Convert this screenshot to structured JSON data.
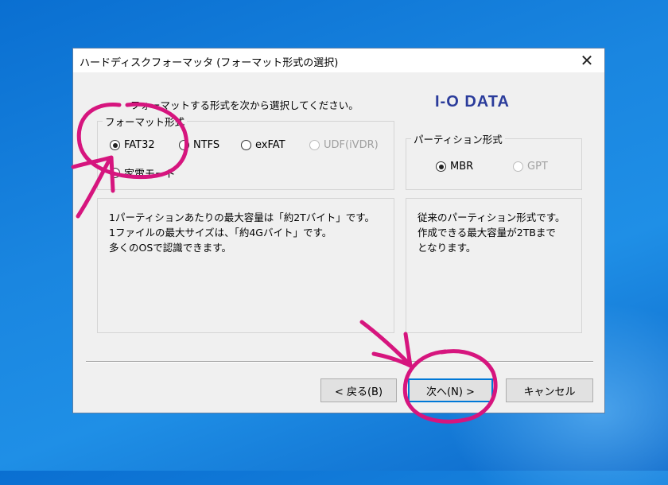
{
  "dialog": {
    "title": "ハードディスクフォーマッタ (フォーマット形式の選択)",
    "close_glyph": "✕",
    "instruction": "フォーマットする形式を次から選択してください。",
    "logo": "I-O DATA"
  },
  "format_group": {
    "legend": "フォーマット形式",
    "options": [
      {
        "label": "FAT32",
        "checked": true,
        "enabled": true
      },
      {
        "label": "NTFS",
        "checked": false,
        "enabled": true
      },
      {
        "label": "exFAT",
        "checked": false,
        "enabled": true
      },
      {
        "label": "UDF(iVDR)",
        "checked": false,
        "enabled": false
      }
    ],
    "extra_option": "家電モード"
  },
  "partition_group": {
    "legend": "パーティション形式",
    "options": [
      {
        "label": "MBR",
        "checked": true,
        "enabled": true
      },
      {
        "label": "GPT",
        "checked": false,
        "enabled": false
      }
    ]
  },
  "format_description": {
    "lines": [
      "1パーティションあたりの最大容量は「約2Tバイト」です。",
      "1ファイルの最大サイズは、「約4Gバイト」です。",
      "多くのOSで認識できます。"
    ]
  },
  "partition_description": {
    "lines": [
      "従来のパーティション形式です。",
      "作成できる最大容量が2TBまで",
      "となります。"
    ]
  },
  "buttons": {
    "back": "< 戻る(B)",
    "next": "次へ(N) >",
    "cancel": "キャンセル"
  },
  "colors": {
    "annotation": "#d6157e",
    "logo": "#2b3c9b",
    "focus": "#0078d7"
  }
}
